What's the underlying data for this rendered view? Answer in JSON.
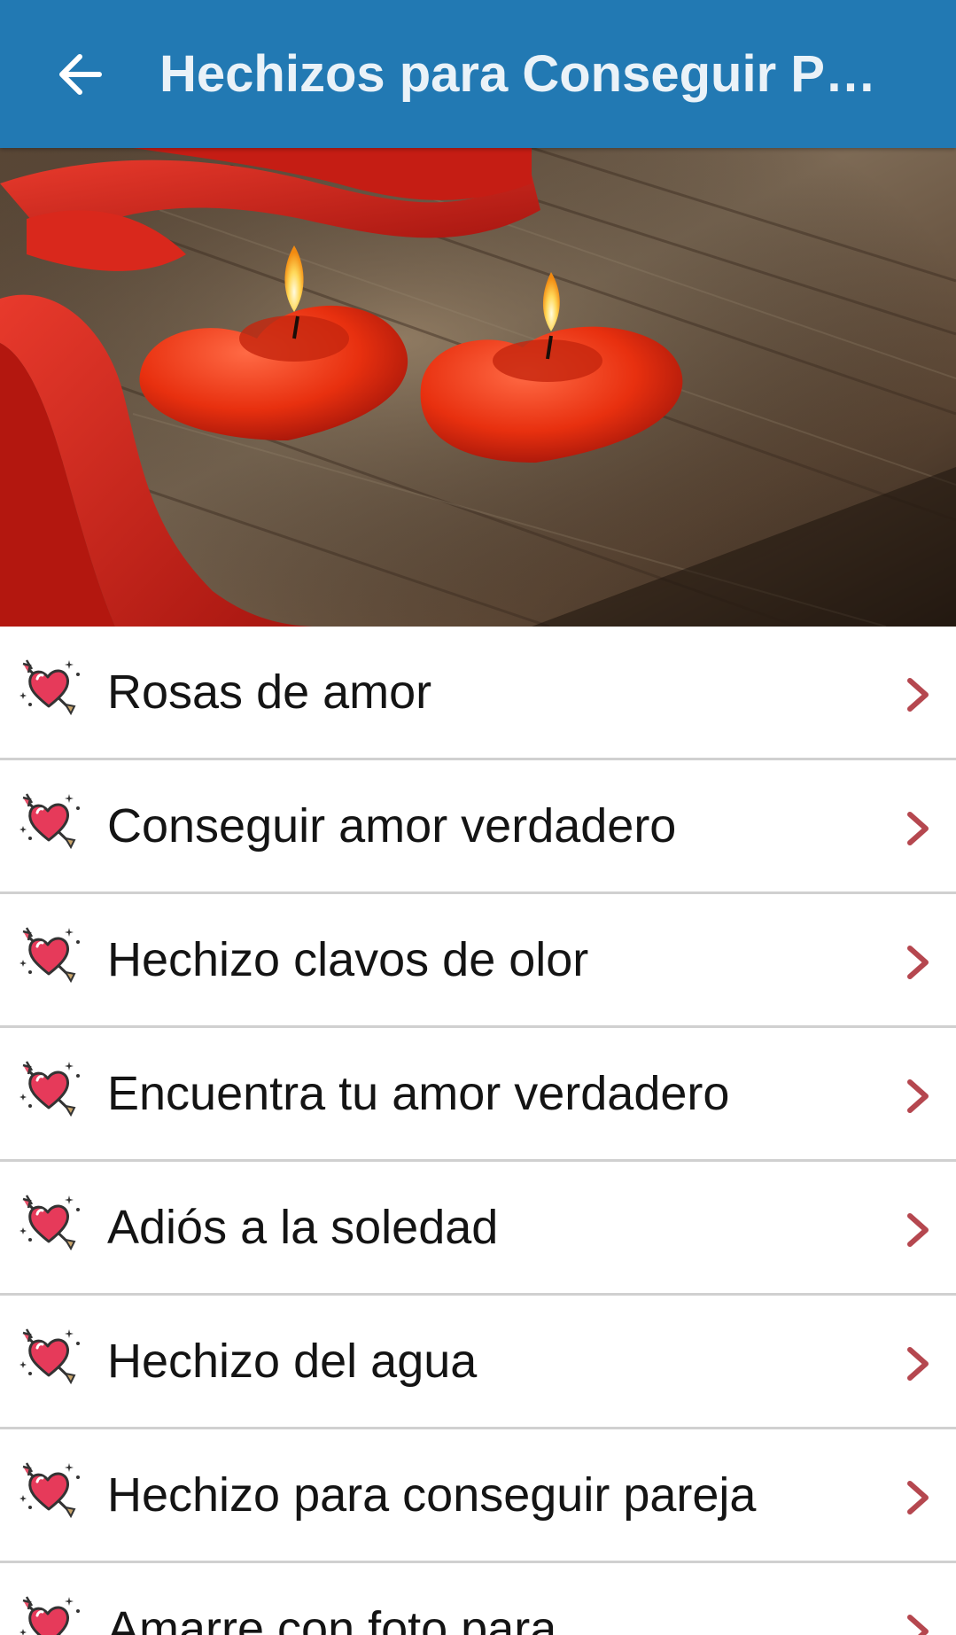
{
  "toolbar": {
    "back_icon": "arrow-left-icon",
    "title": "Hechizos para Conseguir Par…",
    "background": "#2279b3"
  },
  "hero": {
    "description_icon": "heart-candles-image"
  },
  "list": {
    "item_icon": "heart-arrow-icon",
    "chevron_icon": "chevron-right-icon",
    "accent": "#b5474f",
    "items": [
      {
        "label": "Rosas de amor"
      },
      {
        "label": "Conseguir amor verdadero"
      },
      {
        "label": "Hechizo clavos de olor"
      },
      {
        "label": "Encuentra tu amor verdadero"
      },
      {
        "label": "Adiós a la soledad"
      },
      {
        "label": "Hechizo del agua"
      },
      {
        "label": "Hechizo para conseguir pareja"
      },
      {
        "label": "Amarre con foto para"
      }
    ]
  }
}
